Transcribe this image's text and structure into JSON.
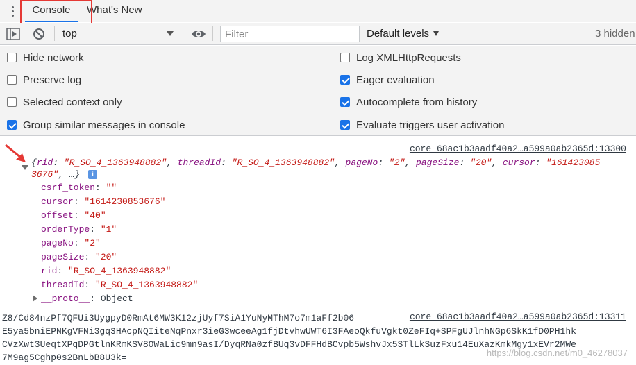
{
  "tabs": [
    {
      "label": "Console",
      "active": true
    },
    {
      "label": "What's New",
      "active": false
    }
  ],
  "toolbar": {
    "context": "top",
    "filter_placeholder": "Filter",
    "levels": "Default levels",
    "hidden": "3 hidden"
  },
  "settings": {
    "left": [
      {
        "label": "Hide network",
        "checked": false
      },
      {
        "label": "Preserve log",
        "checked": false
      },
      {
        "label": "Selected context only",
        "checked": false
      },
      {
        "label": "Group similar messages in console",
        "checked": true
      }
    ],
    "right": [
      {
        "label": "Log XMLHttpRequests",
        "checked": false
      },
      {
        "label": "Eager evaluation",
        "checked": true
      },
      {
        "label": "Autocomplete from history",
        "checked": true
      },
      {
        "label": "Evaluate triggers user activation",
        "checked": true
      }
    ]
  },
  "message1": {
    "source": "core_68ac1b3aadf40a2…a599a0ab2365d:13300",
    "summary": {
      "rid_key": "rid",
      "rid_val": "\"R_SO_4_1363948882\"",
      "threadId_key": "threadId",
      "threadId_val": "\"R_SO_4_1363948882\"",
      "pageNo_key": "pageNo",
      "pageNo_val": "\"2\"",
      "pageSize_key": "pageSize",
      "pageSize_val": "\"20\"",
      "cursor_key": "cursor",
      "cursor_val_a": "\"161423085",
      "cursor_val_b": "3676\"",
      "tail": ", …}"
    },
    "props": [
      {
        "key": "csrf_token",
        "value": "\"\""
      },
      {
        "key": "cursor",
        "value": "\"1614230853676\""
      },
      {
        "key": "offset",
        "value": "\"40\""
      },
      {
        "key": "orderType",
        "value": "\"1\""
      },
      {
        "key": "pageNo",
        "value": "\"2\""
      },
      {
        "key": "pageSize",
        "value": "\"20\""
      },
      {
        "key": "rid",
        "value": "\"R_SO_4_1363948882\""
      },
      {
        "key": "threadId",
        "value": "\"R_SO_4_1363948882\""
      }
    ],
    "proto_key": "__proto__",
    "proto_val": "Object"
  },
  "message2": {
    "source": "core_68ac1b3aadf40a2…a599a0ab2365d:13311",
    "lines": [
      "Z8/Cd84nzPf7QFUi3UygpyD0RmAt6MW3K12zjUyf7SiA1YuNyMThM7o7m1aFf2b06",
      "E5ya5bniEPNKgVFNi3gq3HAcpNQIiteNqPnxr3ieG3wceeAg1fjDtvhwUWT6I3FAeoQkfuVgkt0ZeFIq+SPFgUJlnhNGp6SkK1fD0PH1hk",
      "CVzXwt3UeqtXPqDPGtlnKRmKSV8OWaLic9mn9asI/DyqRNa0zfBUq3vDFFHdBCvpb5WshvJx5STlLkSuzFxu14EuXazKmkMgy1xEVr2MWe",
      "7M9ag5Cghp0s2BnLbB8U3k="
    ]
  },
  "watermark": "https://blog.csdn.net/m0_46278037",
  "colors": {
    "accent": "#1a73e8",
    "highlight": "#e53935",
    "key": "#881280",
    "string": "#c41a16"
  }
}
